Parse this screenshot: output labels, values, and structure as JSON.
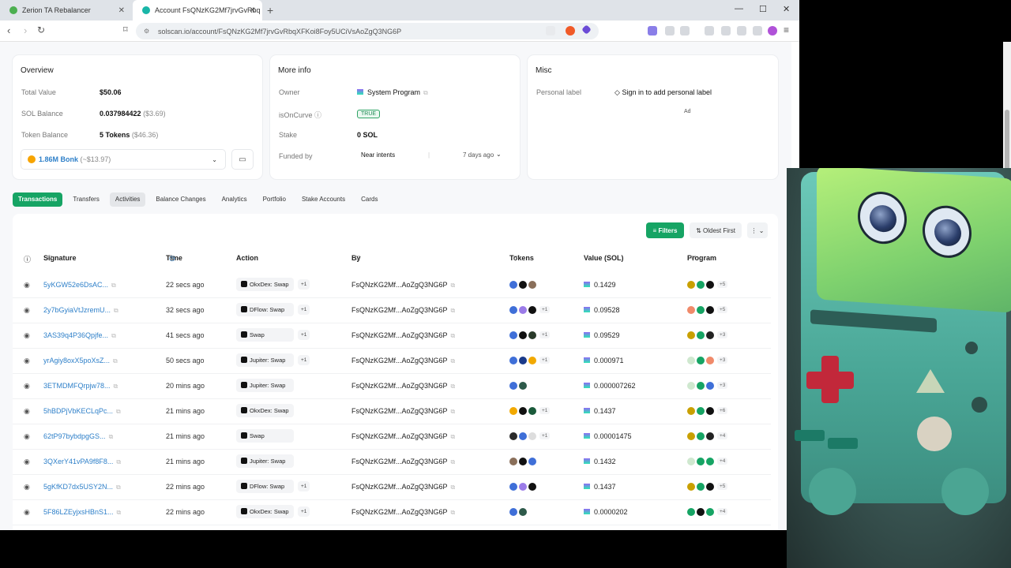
{
  "browser": {
    "tabs": [
      {
        "title": "Zerion TA Rebalancer",
        "active": false
      },
      {
        "title": "Account FsQNzKG2Mf7jrvGvRbq",
        "active": true
      }
    ],
    "url": "solscan.io/account/FsQNzKG2Mf7jrvGvRbqXFKoi8Foy5UCiVsAoZgQ3NG6P"
  },
  "overview": {
    "title": "Overview",
    "total_value_label": "Total Value",
    "total_value": "$50.06",
    "sol_balance_label": "SOL Balance",
    "sol_balance": "0.037984422",
    "sol_balance_usd": "($3.69)",
    "token_balance_label": "Token Balance",
    "token_balance": "5 Tokens",
    "token_balance_usd": "($46.36)",
    "token_select": "1.86M Bonk",
    "token_select_usd": "(~$13.97)"
  },
  "more_info": {
    "title": "More info",
    "owner_label": "Owner",
    "owner": "System Program",
    "is_on_curve_label": "isOnCurve",
    "is_on_curve": "TRUE",
    "stake_label": "Stake",
    "stake": "0 SOL",
    "funded_by_label": "Funded by",
    "funded_by": "Near intents",
    "funded_when": "7 days ago"
  },
  "misc": {
    "title": "Misc",
    "personal_label": "Personal label",
    "sign_in_link": "Sign in to add personal label",
    "ad": "Ad"
  },
  "page_tabs": [
    "Transactions",
    "Transfers",
    "Activities",
    "Balance Changes",
    "Analytics",
    "Portfolio",
    "Stake Accounts",
    "Cards"
  ],
  "toolbar": {
    "filters": "Filters",
    "sort": "Oldest First"
  },
  "columns": {
    "signature": "Signature",
    "time": "Time",
    "action": "Action",
    "by": "By",
    "tokens": "Tokens",
    "value": "Value (SOL)",
    "program": "Program"
  },
  "rows": [
    {
      "sig": "5yKGW52e6DsAC...",
      "time": "22 secs ago",
      "action": "OkxDex: Swap",
      "action_plus": "+1",
      "by": "FsQNzKG2Mf...AoZgQ3NG6P",
      "tokens_plus": "",
      "value": "0.1429",
      "program_plus": "+5"
    },
    {
      "sig": "2y7bGyiaVtJzremU...",
      "time": "32 secs ago",
      "action": "DFlow: Swap",
      "action_plus": "+1",
      "by": "FsQNzKG2Mf...AoZgQ3NG6P",
      "tokens_plus": "+1",
      "value": "0.09528",
      "program_plus": "+5"
    },
    {
      "sig": "3AS39q4P36Qpjfe...",
      "time": "41 secs ago",
      "action": "Swap",
      "action_plus": "+1",
      "by": "FsQNzKG2Mf...AoZgQ3NG6P",
      "tokens_plus": "+1",
      "value": "0.09529",
      "program_plus": "+3"
    },
    {
      "sig": "yrAgiy8oxX5poXsZ...",
      "time": "50 secs ago",
      "action": "Jupiter: Swap",
      "action_plus": "+1",
      "by": "FsQNzKG2Mf...AoZgQ3NG6P",
      "tokens_plus": "+1",
      "value": "0.000971",
      "program_plus": "+3"
    },
    {
      "sig": "3ETMDMFQrpjw78...",
      "time": "20 mins ago",
      "action": "Jupiter: Swap",
      "action_plus": "",
      "by": "FsQNzKG2Mf...AoZgQ3NG6P",
      "tokens_plus": "",
      "value": "0.000007262",
      "program_plus": "+3"
    },
    {
      "sig": "5hBDPjVbKECLqPc...",
      "time": "21 mins ago",
      "action": "OkxDex: Swap",
      "action_plus": "",
      "by": "FsQNzKG2Mf...AoZgQ3NG6P",
      "tokens_plus": "+1",
      "value": "0.1437",
      "program_plus": "+6"
    },
    {
      "sig": "62tP97bybdpgGS...",
      "time": "21 mins ago",
      "action": "Swap",
      "action_plus": "",
      "by": "FsQNzKG2Mf...AoZgQ3NG6P",
      "tokens_plus": "+1",
      "value": "0.00001475",
      "program_plus": "+4"
    },
    {
      "sig": "3QXerY41vPA9f8F8...",
      "time": "21 mins ago",
      "action": "Jupiter: Swap",
      "action_plus": "",
      "by": "FsQNzKG2Mf...AoZgQ3NG6P",
      "tokens_plus": "",
      "value": "0.1432",
      "program_plus": "+4"
    },
    {
      "sig": "5gKfKD7dx5USY2N...",
      "time": "22 mins ago",
      "action": "DFlow: Swap",
      "action_plus": "+1",
      "by": "FsQNzKG2Mf...AoZgQ3NG6P",
      "tokens_plus": "",
      "value": "0.1437",
      "program_plus": "+5"
    },
    {
      "sig": "5F86LZEyjxsHBnS1...",
      "time": "22 mins ago",
      "action": "OkxDex: Swap",
      "action_plus": "+1",
      "by": "FsQNzKG2Mf...AoZgQ3NG6P",
      "tokens_plus": "",
      "value": "0.0000202",
      "program_plus": "+4"
    }
  ],
  "colors": {
    "accent": "#16a464",
    "link": "#2f80c9"
  }
}
